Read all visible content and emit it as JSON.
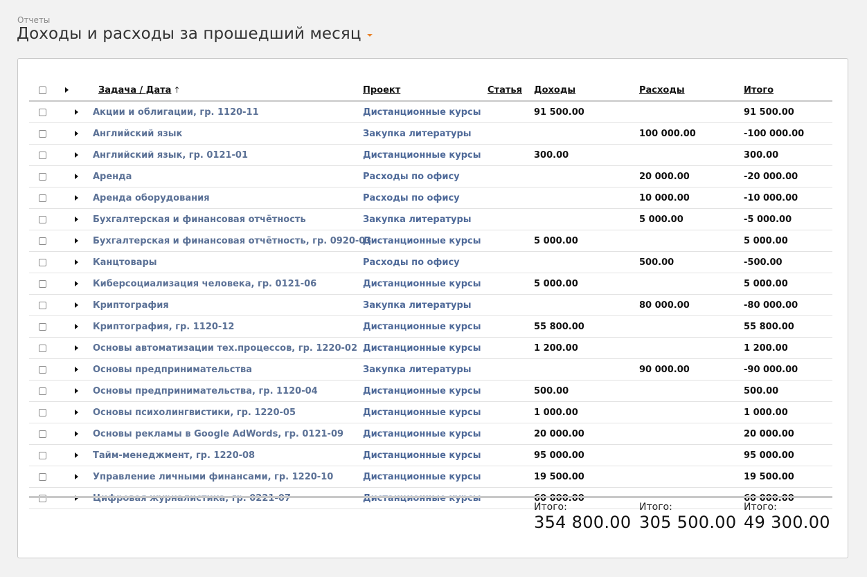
{
  "breadcrumb": "Отчеты",
  "page_title": "Доходы и расходы за прошедший месяц",
  "colors": {
    "accent": "#e8822a",
    "link": "#5b7196",
    "project_link": "#4f6a99"
  },
  "columns": {
    "task": "Задача / Дата",
    "sort_arrow": "↑",
    "project": "Проект",
    "article": "Статья",
    "income": "Доходы",
    "expense": "Расходы",
    "total": "Итого"
  },
  "rows": [
    {
      "task": "Акции и облигации, гр. 1120-11",
      "project": "Дистанционные курсы",
      "income": "91 500.00",
      "expense": "",
      "total": "91 500.00"
    },
    {
      "task": "Английский язык",
      "project": "Закупка литературы",
      "income": "",
      "expense": "100 000.00",
      "total": "-100 000.00"
    },
    {
      "task": "Английский язык, гр. 0121-01",
      "project": "Дистанционные курсы",
      "income": "300.00",
      "expense": "",
      "total": "300.00"
    },
    {
      "task": "Аренда",
      "project": "Расходы по офису",
      "income": "",
      "expense": "20 000.00",
      "total": "-20 000.00"
    },
    {
      "task": "Аренда оборудования",
      "project": "Расходы по офису",
      "income": "",
      "expense": "10 000.00",
      "total": "-10 000.00"
    },
    {
      "task": "Бухгалтерская и финансовая отчётность",
      "project": "Закупка литературы",
      "income": "",
      "expense": "5 000.00",
      "total": "-5 000.00"
    },
    {
      "task": "Бухгалтерская и финансовая отчётность, гр. 0920-03",
      "project": "Дистанционные курсы",
      "income": "5 000.00",
      "expense": "",
      "total": "5 000.00"
    },
    {
      "task": "Канцтовары",
      "project": "Расходы по офису",
      "income": "",
      "expense": "500.00",
      "total": "-500.00"
    },
    {
      "task": "Киберсоциализация человека, гр. 0121-06",
      "project": "Дистанционные курсы",
      "income": "5 000.00",
      "expense": "",
      "total": "5 000.00"
    },
    {
      "task": "Криптография",
      "project": "Закупка литературы",
      "income": "",
      "expense": "80 000.00",
      "total": "-80 000.00"
    },
    {
      "task": "Криптография, гр. 1120-12",
      "project": "Дистанционные курсы",
      "income": "55 800.00",
      "expense": "",
      "total": "55 800.00"
    },
    {
      "task": "Основы автоматизации тех.процессов, гр. 1220-02",
      "project": "Дистанционные курсы",
      "income": "1 200.00",
      "expense": "",
      "total": "1 200.00"
    },
    {
      "task": "Основы предпринимательства",
      "project": "Закупка литературы",
      "income": "",
      "expense": "90 000.00",
      "total": "-90 000.00"
    },
    {
      "task": "Основы предпринимательства, гр. 1120-04",
      "project": "Дистанционные курсы",
      "income": "500.00",
      "expense": "",
      "total": "500.00"
    },
    {
      "task": "Основы психолингвистики, гр. 1220-05",
      "project": "Дистанционные курсы",
      "income": "1 000.00",
      "expense": "",
      "total": "1 000.00"
    },
    {
      "task": "Основы рекламы в Google AdWords, гр. 0121-09",
      "project": "Дистанционные курсы",
      "income": "20 000.00",
      "expense": "",
      "total": "20 000.00"
    },
    {
      "task": "Тайм-менеджмент, гр. 1220-08",
      "project": "Дистанционные курсы",
      "income": "95 000.00",
      "expense": "",
      "total": "95 000.00"
    },
    {
      "task": "Управление личными финансами, гр. 1220-10",
      "project": "Дистанционные курсы",
      "income": "19 500.00",
      "expense": "",
      "total": "19 500.00"
    },
    {
      "task": "Цифровая журналистика, гр. 0221-07",
      "project": "Дистанционные курсы",
      "income": "60 000.00",
      "expense": "",
      "total": "60 000.00"
    }
  ],
  "summary": {
    "income_label": "Итого:",
    "income_value": "354 800.00",
    "expense_label": "Итого:",
    "expense_value": "305 500.00",
    "total_label": "Итого:",
    "total_value": "49 300.00"
  }
}
